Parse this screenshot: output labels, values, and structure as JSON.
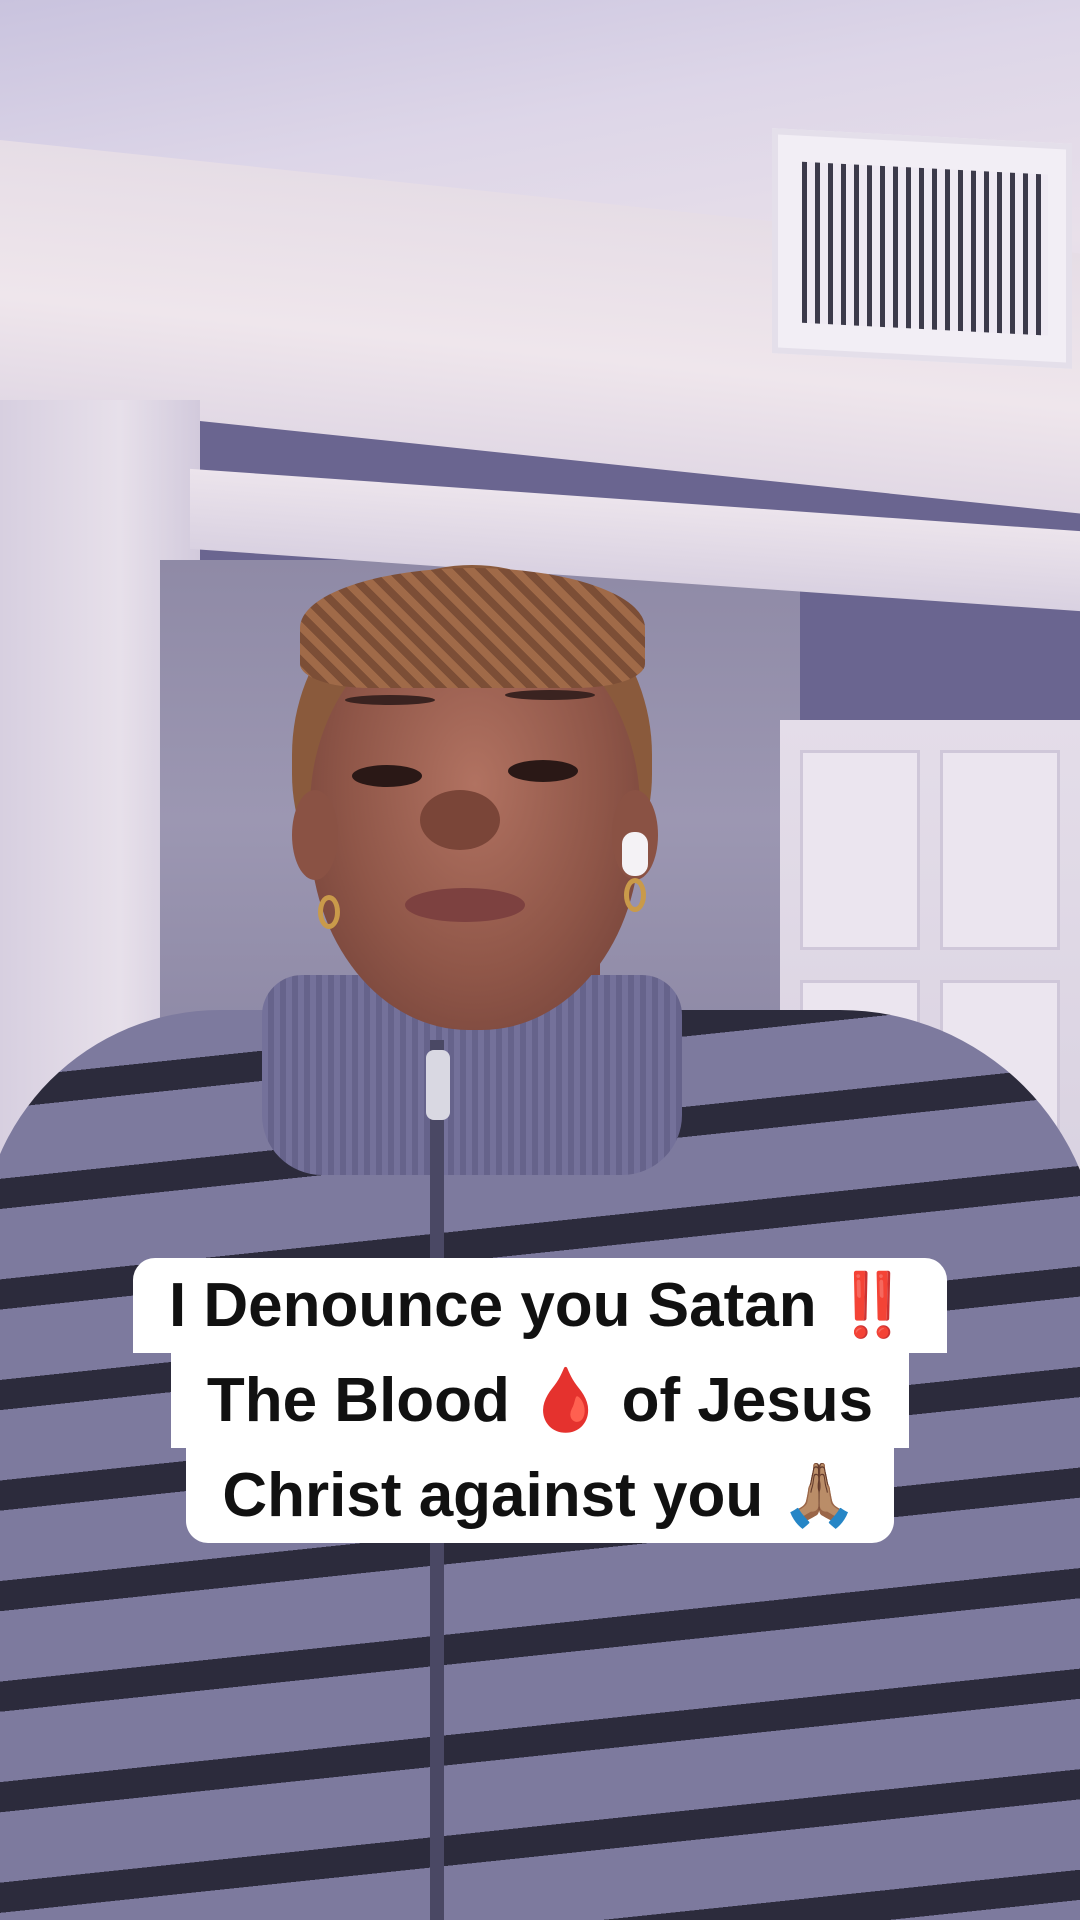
{
  "caption": {
    "lines": [
      {
        "text": "I Denounce you Satan",
        "emoji": "‼️"
      },
      {
        "text_before": "The Blood",
        "emoji": "🩸",
        "text_after": "of Jesus"
      },
      {
        "text": "Christ against you",
        "emoji": "🙏🏽"
      }
    ]
  },
  "colors": {
    "caption_background": "#ffffff",
    "caption_text": "#111111",
    "emoji_red": "#e1181f"
  },
  "icons": [
    "double-exclamation-icon",
    "blood-drop-icon",
    "praying-hands-icon"
  ]
}
